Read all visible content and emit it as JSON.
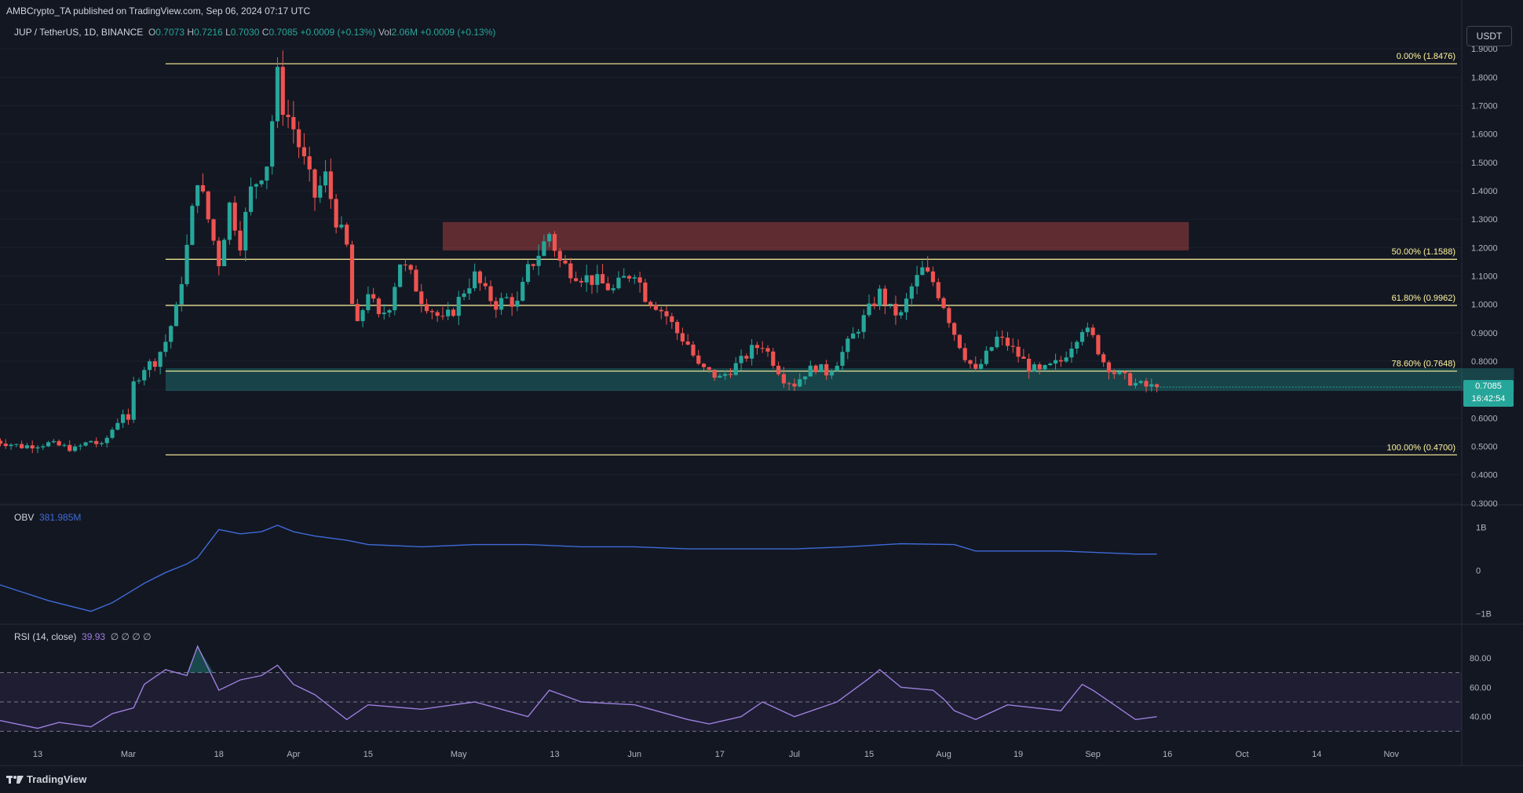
{
  "header": {
    "published": "AMBCrypto_TA published on TradingView.com, Sep 06, 2024 07:17 UTC"
  },
  "legend": {
    "symbol": "JUP / TetherUS, 1D, BINANCE",
    "o_label": "O",
    "o": "0.7073",
    "h_label": "H",
    "h": "0.7216",
    "l_label": "L",
    "l": "0.7030",
    "c_label": "C",
    "c": "0.7085",
    "change": "+0.0009 (+0.13%)",
    "vol_label": "Vol",
    "vol": "2.06M",
    "vol_change": "+0.0009 (+0.13%)"
  },
  "currency": "USDT",
  "last_price": {
    "price": "0.7085",
    "countdown": "16:42:54"
  },
  "obv_label": {
    "name": "OBV",
    "value": "381.985M"
  },
  "rsi_label": {
    "name": "RSI (14, close)",
    "value": "39.93",
    "extra": "∅ ∅ ∅ ∅"
  },
  "footer": {
    "brand": "TradingView"
  },
  "colors": {
    "background": "#131722",
    "up": "#26a69a",
    "down": "#ef5350",
    "fib": "#fff59d",
    "obv": "#3f6ad8",
    "rsi": "#9c7fdc",
    "support_zone": "#26a69a",
    "resistance_zone": "#ef5350"
  },
  "chart_data": [
    {
      "type": "candlestick",
      "title": "JUP / TetherUS, 1D, BINANCE",
      "price_axis": {
        "ticks": [
          "1.9000",
          "1.8000",
          "1.7000",
          "1.6000",
          "1.5000",
          "1.4000",
          "1.3000",
          "1.2000",
          "1.1000",
          "1.0000",
          "0.9000",
          "0.8000",
          "0.7000",
          "0.6000",
          "0.5000",
          "0.4000",
          "0.3000"
        ],
        "ylim": [
          0.28,
          1.92
        ]
      },
      "time_axis": {
        "ticks": [
          "13",
          "Mar",
          "18",
          "Apr",
          "15",
          "May",
          "13",
          "Jun",
          "17",
          "Jul",
          "15",
          "Aug",
          "19",
          "Sep",
          "16",
          "Oct",
          "14",
          "Nov"
        ]
      },
      "fib_levels": [
        {
          "label": "0.00% (1.8476)",
          "price": 1.8476
        },
        {
          "label": "50.00% (1.1588)",
          "price": 1.1588
        },
        {
          "label": "61.80% (0.9962)",
          "price": 0.9962
        },
        {
          "label": "78.60% (0.7648)",
          "price": 0.7648
        },
        {
          "label": "100.00% (0.4700)",
          "price": 0.47
        }
      ],
      "zones": [
        {
          "kind": "resistance",
          "price_top": 1.29,
          "price_bottom": 1.19,
          "start_day": 76,
          "end_day": 216
        },
        {
          "kind": "support",
          "price_top": 0.775,
          "price_bottom": 0.695,
          "start_day": 24,
          "end_day": 277
        }
      ],
      "day0": "2024-02-05",
      "anchors_days_closes": [
        [
          0,
          0.52
        ],
        [
          5,
          0.5
        ],
        [
          10,
          0.51
        ],
        [
          15,
          0.49
        ],
        [
          18,
          0.52
        ],
        [
          20,
          0.5
        ],
        [
          22,
          0.56
        ],
        [
          24,
          0.62
        ],
        [
          25,
          0.58
        ],
        [
          26,
          0.72
        ],
        [
          28,
          0.78
        ],
        [
          30,
          0.8
        ],
        [
          32,
          0.87
        ],
        [
          34,
          0.98
        ],
        [
          36,
          1.2
        ],
        [
          38,
          1.45
        ],
        [
          40,
          1.3
        ],
        [
          42,
          1.15
        ],
        [
          44,
          1.35
        ],
        [
          46,
          1.22
        ],
        [
          48,
          1.4
        ],
        [
          51,
          1.5
        ],
        [
          53,
          1.8
        ],
        [
          54,
          1.7
        ],
        [
          56,
          1.62
        ],
        [
          58,
          1.5
        ],
        [
          60,
          1.38
        ],
        [
          62,
          1.45
        ],
        [
          64,
          1.3
        ],
        [
          66,
          1.2
        ],
        [
          67,
          1.0
        ],
        [
          68,
          0.92
        ],
        [
          70,
          1.05
        ],
        [
          72,
          0.95
        ],
        [
          74,
          1.0
        ],
        [
          76,
          1.15
        ],
        [
          78,
          1.1
        ],
        [
          80,
          1.02
        ],
        [
          82,
          0.98
        ],
        [
          84,
          0.94
        ],
        [
          86,
          0.98
        ],
        [
          88,
          1.05
        ],
        [
          90,
          1.1
        ],
        [
          92,
          1.04
        ],
        [
          94,
          1.0
        ],
        [
          96,
          1.02
        ],
        [
          98,
          1.0
        ],
        [
          100,
          1.12
        ],
        [
          102,
          1.18
        ],
        [
          104,
          1.25
        ],
        [
          106,
          1.15
        ],
        [
          108,
          1.12
        ],
        [
          110,
          1.1
        ],
        [
          113,
          1.08
        ],
        [
          116,
          1.05
        ],
        [
          118,
          1.09
        ],
        [
          120,
          1.12
        ],
        [
          122,
          1.03
        ],
        [
          124,
          1.0
        ],
        [
          126,
          0.96
        ],
        [
          128,
          0.9
        ],
        [
          130,
          0.86
        ],
        [
          132,
          0.78
        ],
        [
          134,
          0.76
        ],
        [
          136,
          0.74
        ],
        [
          138,
          0.77
        ],
        [
          140,
          0.8
        ],
        [
          142,
          0.84
        ],
        [
          144,
          0.86
        ],
        [
          146,
          0.8
        ],
        [
          148,
          0.74
        ],
        [
          150,
          0.72
        ],
        [
          152,
          0.76
        ],
        [
          154,
          0.78
        ],
        [
          156,
          0.76
        ],
        [
          158,
          0.8
        ],
        [
          160,
          0.86
        ],
        [
          162,
          0.92
        ],
        [
          164,
          0.98
        ],
        [
          166,
          1.04
        ],
        [
          168,
          0.98
        ],
        [
          170,
          0.96
        ],
        [
          172,
          1.06
        ],
        [
          174,
          1.12
        ],
        [
          176,
          1.08
        ],
        [
          178,
          1.0
        ],
        [
          180,
          0.9
        ],
        [
          182,
          0.82
        ],
        [
          184,
          0.76
        ],
        [
          186,
          0.82
        ],
        [
          188,
          0.88
        ],
        [
          190,
          0.86
        ],
        [
          192,
          0.82
        ],
        [
          194,
          0.78
        ],
        [
          196,
          0.76
        ],
        [
          198,
          0.78
        ],
        [
          200,
          0.8
        ],
        [
          202,
          0.86
        ],
        [
          204,
          0.92
        ],
        [
          206,
          0.88
        ],
        [
          208,
          0.8
        ],
        [
          210,
          0.76
        ],
        [
          212,
          0.74
        ],
        [
          214,
          0.72
        ],
        [
          216,
          0.71
        ],
        [
          218,
          0.7085
        ]
      ],
      "last_close": 0.7085
    },
    {
      "type": "line",
      "name": "OBV",
      "value_label": "381.985M",
      "axis_ticks": [
        "1B",
        "0",
        "−1B"
      ],
      "ylim": [
        -1.25,
        1.25
      ],
      "x_days": [
        0,
        10,
        18,
        22,
        26,
        28,
        32,
        36,
        38,
        42,
        46,
        50,
        53,
        56,
        60,
        66,
        70,
        80,
        90,
        100,
        110,
        120,
        130,
        140,
        150,
        160,
        170,
        180,
        184,
        190,
        200,
        210,
        214,
        218
      ],
      "values_billions": [
        -0.3,
        -0.7,
        -0.95,
        -0.75,
        -0.45,
        -0.3,
        -0.05,
        0.15,
        0.3,
        0.95,
        0.85,
        0.9,
        1.05,
        0.9,
        0.8,
        0.7,
        0.6,
        0.55,
        0.6,
        0.6,
        0.55,
        0.55,
        0.5,
        0.5,
        0.5,
        0.55,
        0.62,
        0.6,
        0.45,
        0.45,
        0.45,
        0.4,
        0.38,
        0.38
      ]
    },
    {
      "type": "line",
      "name": "RSI (14, close)",
      "value_label": "39.93",
      "axis_ticks": [
        "80.00",
        "60.00",
        "40.00"
      ],
      "bands": [
        70,
        50,
        30
      ],
      "ylim": [
        20,
        95
      ],
      "x_days": [
        0,
        8,
        12,
        18,
        22,
        26,
        28,
        32,
        36,
        38,
        42,
        46,
        50,
        53,
        56,
        60,
        66,
        70,
        80,
        90,
        100,
        104,
        110,
        120,
        126,
        130,
        134,
        140,
        144,
        150,
        158,
        164,
        166,
        170,
        176,
        178,
        180,
        184,
        190,
        200,
        204,
        206,
        210,
        214,
        218
      ],
      "values": [
        38,
        32,
        36,
        33,
        42,
        46,
        62,
        72,
        68,
        88,
        58,
        65,
        68,
        75,
        62,
        55,
        38,
        48,
        45,
        50,
        40,
        58,
        50,
        48,
        42,
        38,
        35,
        40,
        50,
        40,
        50,
        66,
        72,
        60,
        58,
        52,
        44,
        38,
        48,
        44,
        62,
        58,
        48,
        38,
        39.93
      ]
    }
  ]
}
